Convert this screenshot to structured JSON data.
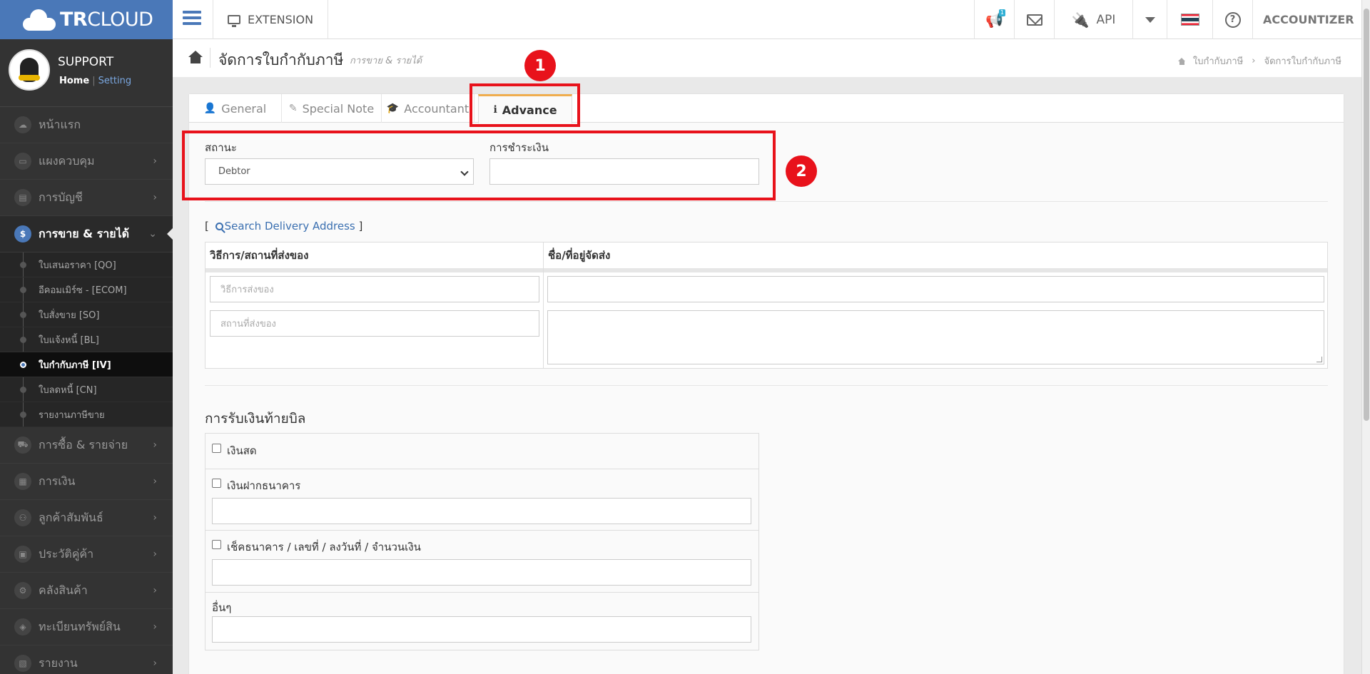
{
  "brand": {
    "text_bold": "TR",
    "text_light": "CLOUD"
  },
  "topbar": {
    "extension_label": "EXTENSION",
    "notify_count": "1",
    "api_label": "API",
    "user_label": "ACCOUNTIZER",
    "colors": {
      "brand": "#4a78b8",
      "notify": "#d81b60"
    }
  },
  "profile": {
    "name": "SUPPORT",
    "home": "Home",
    "sep": "|",
    "setting": "Setting"
  },
  "sidebar": {
    "items": [
      {
        "label": "หน้าแรก",
        "icon": "cloud-icon",
        "glyph": "☁"
      },
      {
        "label": "แผงควบคุม",
        "icon": "monitor-icon",
        "glyph": "▭"
      },
      {
        "label": "การบัญชี",
        "icon": "book-icon",
        "glyph": "▤"
      },
      {
        "label": "การขาย & รายได้",
        "icon": "dollar-icon",
        "glyph": "$"
      }
    ],
    "sub_items": [
      {
        "label": "ใบเสนอราคา [QO]"
      },
      {
        "label": "อีคอมเมิร์ซ - [ECOM]"
      },
      {
        "label": "ใบสั่งขาย [SO]"
      },
      {
        "label": "ใบแจ้งหนี้ [BL]"
      },
      {
        "label": "ใบกำกับภาษี [IV]"
      },
      {
        "label": "ใบลดหนี้ [CN]"
      },
      {
        "label": "รายงานภาษีขาย"
      }
    ],
    "items_after": [
      {
        "label": "การซื้อ & รายจ่าย",
        "icon": "cart-icon",
        "glyph": "⛟"
      },
      {
        "label": "การเงิน",
        "icon": "calendar-icon",
        "glyph": "▦"
      },
      {
        "label": "ลูกค้าสัมพันธ์",
        "icon": "users-icon",
        "glyph": "⚇"
      },
      {
        "label": "ประวัติคู่ค้า",
        "icon": "contact-icon",
        "glyph": "▣"
      },
      {
        "label": "คลังสินค้า",
        "icon": "boxes-icon",
        "glyph": "⚙"
      },
      {
        "label": "ทะเบียนทรัพย์สิน",
        "icon": "diamond-icon",
        "glyph": "◈"
      },
      {
        "label": "รายงาน",
        "icon": "report-icon",
        "glyph": "▧"
      }
    ],
    "chevron": "›",
    "chevron_open": "⌄"
  },
  "page": {
    "title": "จัดการใบกำกับภาษี",
    "subtitle": "การขาย & รายได้",
    "breadcrumb": [
      "ใบกำกับภาษี",
      "จัดการใบกำกับภาษี"
    ],
    "breadcrumb_sep": "›"
  },
  "tabs": [
    {
      "label": "General",
      "glyph": "👤"
    },
    {
      "label": "Special Note",
      "glyph": "✎"
    },
    {
      "label": "Accountant",
      "glyph": "🎓"
    },
    {
      "label": "Advance",
      "glyph": "ℹ"
    }
  ],
  "advance": {
    "status_label": "สถานะ",
    "status_value": "Debtor",
    "payment_label": "การชำระเงิน",
    "payment_value": ""
  },
  "delivery": {
    "search_open": "[",
    "search_label": "Search Delivery Address",
    "search_close": "]",
    "col_method": "วิธีการ/สถานที่ส่งของ",
    "col_address": "ชื่อ/ที่อยู่จัดส่ง",
    "method_placeholder": "วิธีการส่งของ",
    "place_placeholder": "สถานที่ส่งของ"
  },
  "payment_receipt": {
    "title": "การรับเงินท้ายบิล",
    "cash": "เงินสด",
    "bank": "เงินฝากธนาคาร",
    "cheque": "เช็คธนาคาร / เลขที่ / ลงวันที่ / จำนวนเงิน",
    "other": "อื่นๆ"
  },
  "annotations": {
    "marker1": "1",
    "marker2": "2",
    "color": "#e8121b"
  }
}
